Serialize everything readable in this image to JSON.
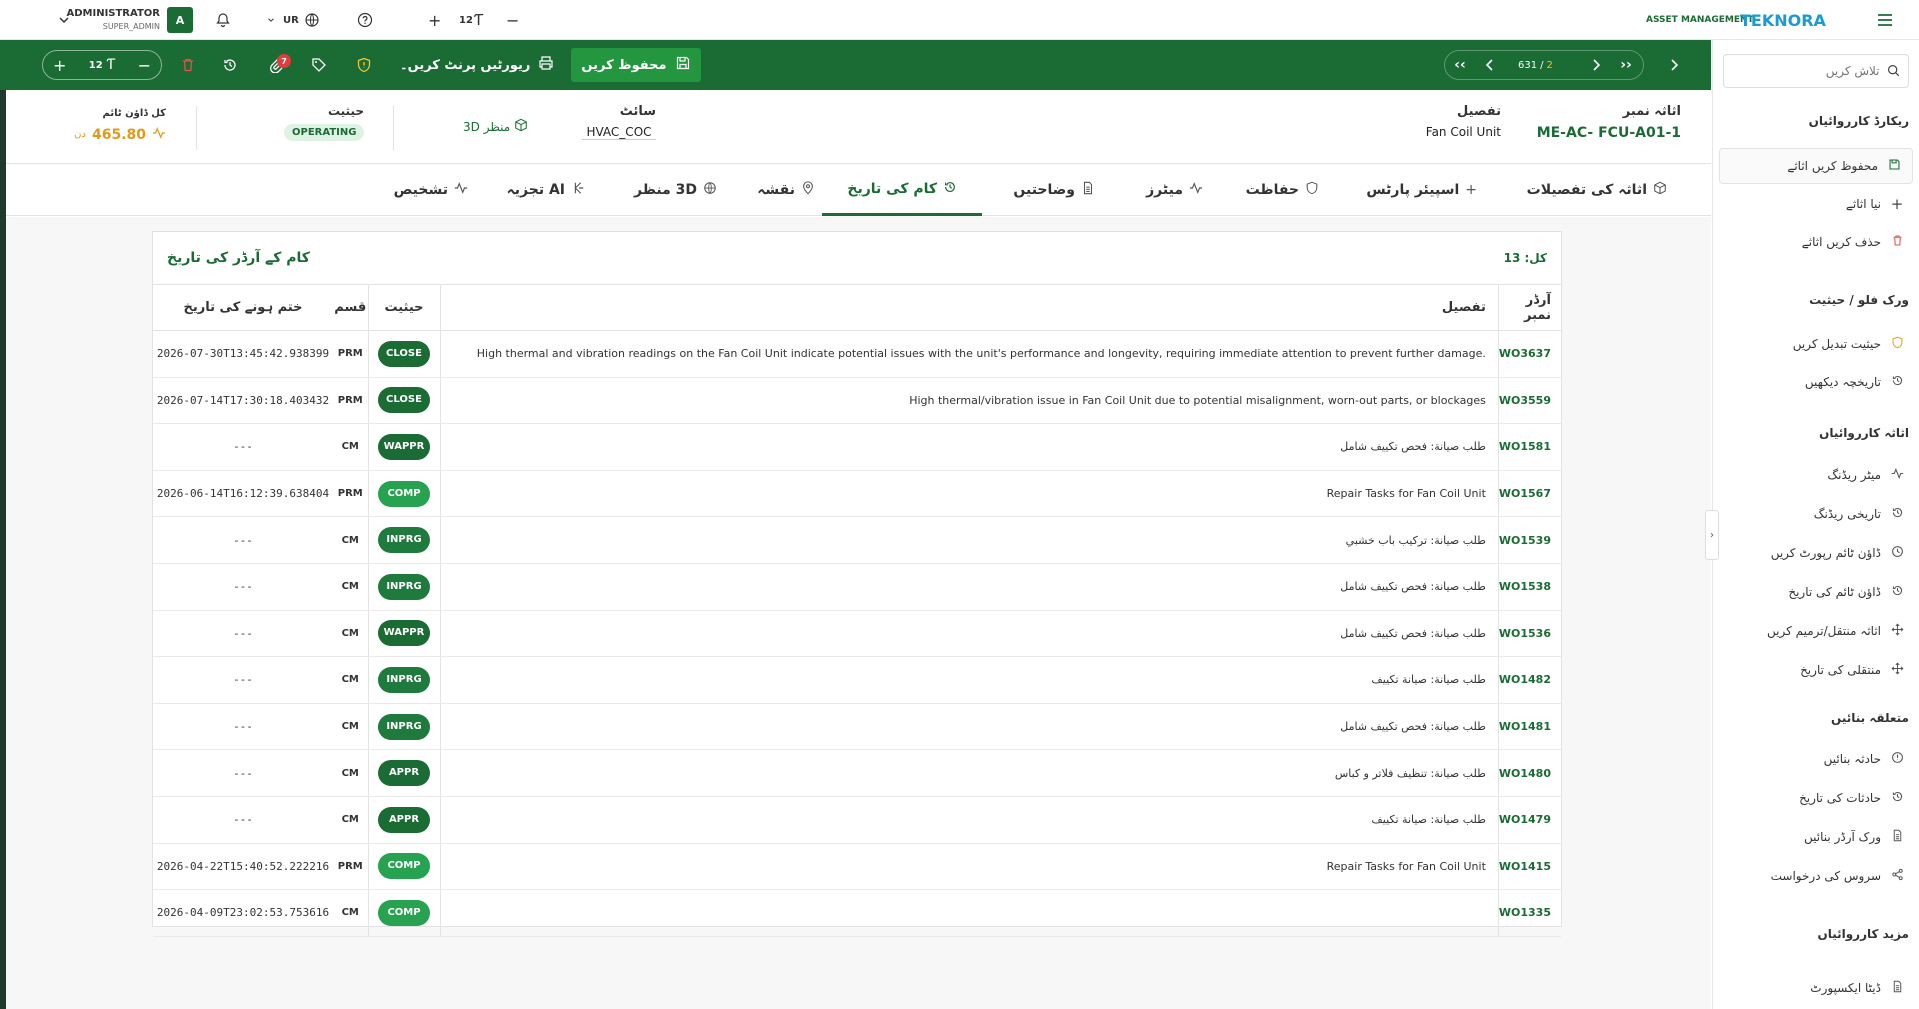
{
  "topbar": {
    "user_name": "ADMINISTRATOR",
    "user_role": "SUPER_ADMIN",
    "avatar_letter": "A",
    "language": "UR",
    "font_size": "12",
    "brand_prefix": "ASSET MANAGEMENT",
    "brand_name": "TEKNORA"
  },
  "toolbar": {
    "save_label": "محفوظ کریں",
    "print_label": "ریورٹیں پرنٹ کریں۔",
    "font_size": "12",
    "attachments_count": "7",
    "pager_current": "631",
    "pager_sep": "/",
    "pager_total": "2"
  },
  "info": {
    "asset_number_label": "اثاثہ نمبر",
    "asset_number": "ME-AC- FCU-A01-1",
    "description_label": "تفصیل",
    "description": "Fan Coil Unit",
    "site_label": "سائٹ",
    "site": "HVAC_COC",
    "view3d_label": "3D منظر",
    "status_label": "حیثیت",
    "status": "OPERATING",
    "downtime_label": "کل ڈاؤن ٹائم",
    "downtime_value": "465.80",
    "downtime_unit": "دن"
  },
  "tabs": [
    {
      "label": "اثاثہ کی تفصیلات",
      "icon": "cube-icon"
    },
    {
      "label": "اسپیئر پارٹس",
      "icon": "plus-icon"
    },
    {
      "label": "حفاظت",
      "icon": "shield-icon"
    },
    {
      "label": "میٹرز",
      "icon": "pulse-icon"
    },
    {
      "label": "وضاحتیں",
      "icon": "document-icon"
    },
    {
      "label": "کام کی تاریخ",
      "icon": "history-icon"
    },
    {
      "label": "نقشہ",
      "icon": "map-pin-icon"
    },
    {
      "label": "3D منظر",
      "icon": "globe-icon"
    },
    {
      "label": "AI تجزیہ",
      "icon": "ai-icon"
    },
    {
      "label": "تشخیص",
      "icon": "pulse-icon"
    }
  ],
  "card": {
    "title": "کام کے آرڈر کی تاریخ",
    "total_label": "کل: 13",
    "columns": {
      "order": "آرڈر نمبر",
      "description": "تفصیل",
      "status": "حیثیت",
      "type": "قسم",
      "end_date": "ختم ہونے کی تاریخ"
    },
    "rows": [
      {
        "wo": "WO3637",
        "desc": "High thermal and vibration readings on the Fan Coil Unit indicate potential issues with the unit's performance and longevity, requiring immediate attention to prevent further damage.",
        "status": "CLOSE",
        "type": "PRM",
        "date": "2026-07-30T13:45:42.938399"
      },
      {
        "wo": "WO3559",
        "desc": "High thermal/vibration issue in Fan Coil Unit due to potential misalignment, worn-out parts, or blockages",
        "status": "CLOSE",
        "type": "PRM",
        "date": "2026-07-14T17:30:18.403432"
      },
      {
        "wo": "WO1581",
        "desc": "طلب صيانة: فحص تكييف شامل",
        "status": "WAPPR",
        "type": "CM",
        "date": "---"
      },
      {
        "wo": "WO1567",
        "desc": "Repair Tasks for Fan Coil Unit",
        "status": "COMP",
        "type": "PRM",
        "date": "2026-06-14T16:12:39.638404"
      },
      {
        "wo": "WO1539",
        "desc": "طلب صيانة: تركيب باب خشبي",
        "status": "INPRG",
        "type": "CM",
        "date": "---"
      },
      {
        "wo": "WO1538",
        "desc": "طلب صيانة: فحص تكييف شامل",
        "status": "INPRG",
        "type": "CM",
        "date": "---"
      },
      {
        "wo": "WO1536",
        "desc": "طلب صيانة: فحص تكييف شامل",
        "status": "WAPPR",
        "type": "CM",
        "date": "---"
      },
      {
        "wo": "WO1482",
        "desc": "طلب صيانة: صيانة تكييف",
        "status": "INPRG",
        "type": "CM",
        "date": "---"
      },
      {
        "wo": "WO1481",
        "desc": "طلب صيانة: فحص تكييف شامل",
        "status": "INPRG",
        "type": "CM",
        "date": "---"
      },
      {
        "wo": "WO1480",
        "desc": "طلب صيانة: تنظيف فلاتر و كباس",
        "status": "APPR",
        "type": "CM",
        "date": "---"
      },
      {
        "wo": "WO1479",
        "desc": "طلب صيانة: صيانة تكييف",
        "status": "APPR",
        "type": "CM",
        "date": "---"
      },
      {
        "wo": "WO1415",
        "desc": "Repair Tasks for Fan Coil Unit",
        "status": "COMP",
        "type": "PRM",
        "date": "2026-04-22T15:40:52.222216"
      },
      {
        "wo": "WO1335",
        "desc": "",
        "status": "COMP",
        "type": "CM",
        "date": "2026-04-09T23:02:53.753616"
      }
    ]
  },
  "status_colors": {
    "CLOSE": "#1b6b35",
    "WAPPR": "#1b6b35",
    "COMP": "#26a251",
    "INPRG": "#1f7a3d",
    "APPR": "#1b6b35"
  },
  "sidebar": {
    "search_placeholder": "تلاش کریں",
    "sections": [
      {
        "title": "ریکارڈ کارروائیاں",
        "items": [
          {
            "label": "محفوظ کریں اثاثے",
            "icon": "save-icon"
          },
          {
            "label": "نیا اثاثے",
            "icon": "plus-icon"
          },
          {
            "label": "حذف کریں اثاثے",
            "icon": "trash-icon"
          }
        ]
      },
      {
        "title": "ورک فلو / حیثیت",
        "items": [
          {
            "label": "حیثیت تبدیل کریں",
            "icon": "shield-icon"
          },
          {
            "label": "تاریخچہ دیکھیں",
            "icon": "history-icon"
          }
        ]
      },
      {
        "title": "اثاثہ کارروائیاں",
        "items": [
          {
            "label": "میٹر ریڈنگ",
            "icon": "pulse-icon"
          },
          {
            "label": "تاریخی ریڈنگ",
            "icon": "history-icon"
          },
          {
            "label": "ڈاؤن ٹائم رپورٹ کریں",
            "icon": "clock-icon"
          },
          {
            "label": "ڈاؤن ٹائم کی تاریخ",
            "icon": "history-icon"
          },
          {
            "label": "اثاثہ منتقل/ترمیم کریں",
            "icon": "move-icon"
          },
          {
            "label": "منتقلی کی تاریخ",
            "icon": "move-icon"
          }
        ]
      },
      {
        "title": "متعلقہ بنائیں",
        "items": [
          {
            "label": "حادثہ بنائیں",
            "icon": "alert-icon"
          },
          {
            "label": "حادثات کی تاریخ",
            "icon": "history-icon"
          },
          {
            "label": "ورک آرڈر بنائیں",
            "icon": "document-icon"
          },
          {
            "label": "سروس کی درخواست",
            "icon": "share-icon"
          }
        ]
      },
      {
        "title": "مزید کارروائیاں",
        "items": [
          {
            "label": "ڈیٹا ایکسپورٹ",
            "icon": "document-icon"
          }
        ]
      }
    ]
  }
}
